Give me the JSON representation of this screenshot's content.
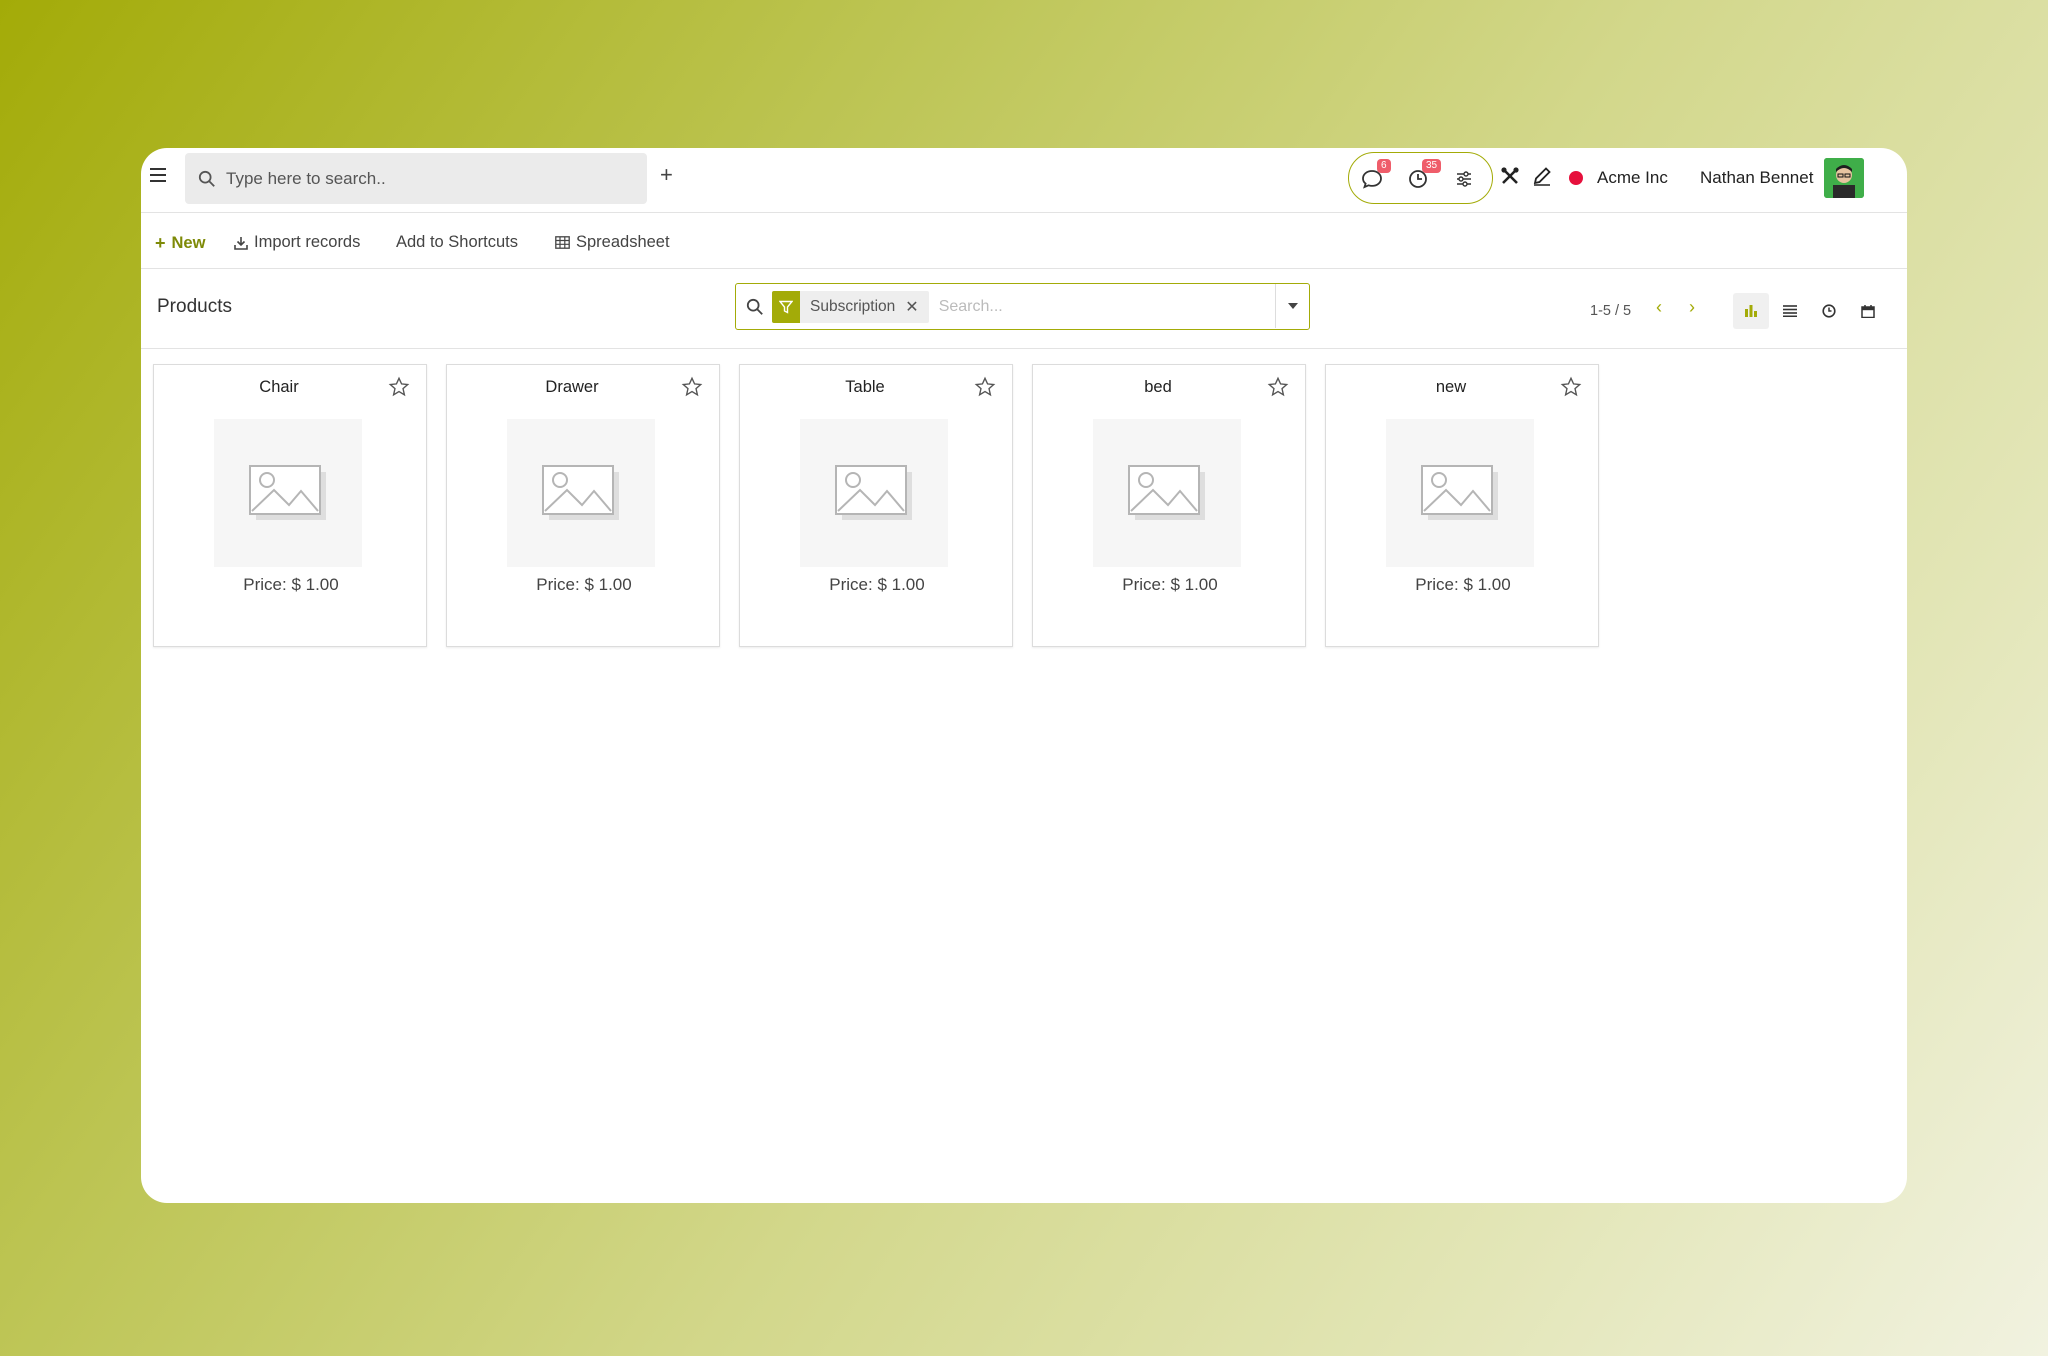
{
  "topbar": {
    "search_placeholder": "Type here to search..",
    "plus_label": "+",
    "messages_badge": "6",
    "activities_badge": "35",
    "company": "Acme Inc",
    "user_name": "Nathan Bennet",
    "status_color": "#e6103c"
  },
  "actions": {
    "new_label": "New",
    "import_label": "Import records",
    "shortcuts_label": "Add to Shortcuts",
    "spreadsheet_label": "Spreadsheet"
  },
  "control": {
    "title": "Products",
    "facet_label": "Subscription",
    "search_placeholder": "Search...",
    "pager_text": "1-5 / 5"
  },
  "products": [
    {
      "name": "Chair",
      "price": "Price: $ 1.00"
    },
    {
      "name": "Drawer",
      "price": "Price: $ 1.00"
    },
    {
      "name": "Table",
      "price": "Price: $ 1.00"
    },
    {
      "name": "bed",
      "price": "Price: $ 1.00"
    },
    {
      "name": "new",
      "price": "Price: $ 1.00"
    }
  ],
  "colors": {
    "accent": "#a3ab08",
    "badge": "#ef5d6a"
  }
}
